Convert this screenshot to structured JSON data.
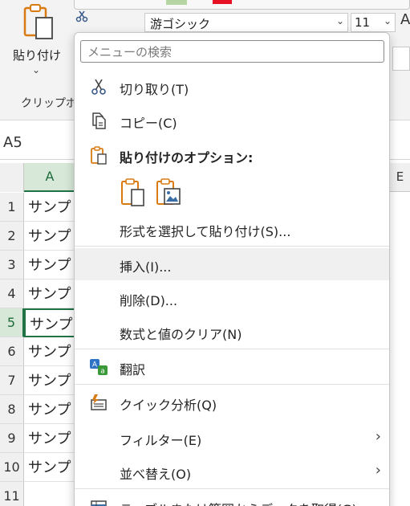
{
  "ribbon": {
    "paste_label": "貼り付け",
    "paste_chevron": "⌄",
    "group_label": "クリップボ",
    "font_name": "游ゴシック",
    "font_size": "11",
    "font_chevron": "⌄",
    "font_letter": "A"
  },
  "namebox": "A5",
  "columns": {
    "a": "A",
    "e": "E"
  },
  "rows": [
    {
      "num": "1",
      "value": "サンプ"
    },
    {
      "num": "2",
      "value": "サンプ"
    },
    {
      "num": "3",
      "value": "サンプ"
    },
    {
      "num": "4",
      "value": "サンプ"
    },
    {
      "num": "5",
      "value": "サンプ"
    },
    {
      "num": "6",
      "value": "サンプ"
    },
    {
      "num": "7",
      "value": "サンプ"
    },
    {
      "num": "8",
      "value": "サンプ"
    },
    {
      "num": "9",
      "value": "サンプ"
    },
    {
      "num": "10",
      "value": "サンプ"
    },
    {
      "num": "11",
      "value": ""
    }
  ],
  "menu": {
    "search_placeholder": "メニューの検索",
    "cut": "切り取り(T)",
    "copy": "コピー(C)",
    "paste_options": "貼り付けのオプション:",
    "paste_special": "形式を選択して貼り付け(S)...",
    "insert": "挿入(I)...",
    "delete": "削除(D)...",
    "clear": "数式と値のクリア(N)",
    "translate": "翻訳",
    "quick_analysis": "クイック分析(Q)",
    "filter": "フィルター(E)",
    "sort": "並べ替え(O)",
    "get_data": "テーブルまたは範囲からデータを取得(G)...",
    "submenu_arrow": "›"
  },
  "colors": {
    "accent_green": "#217346",
    "selected_header": "#d8e8d8",
    "icon_orange": "#d97b12"
  }
}
